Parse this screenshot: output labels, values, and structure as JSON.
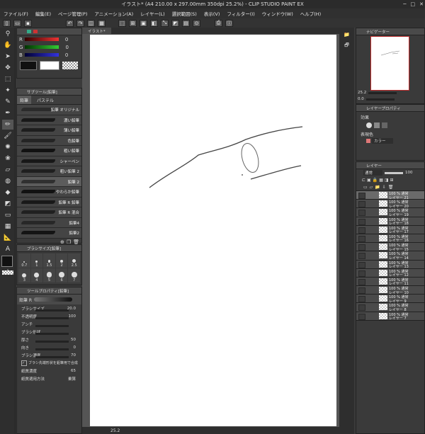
{
  "title": "イラスト* (A4 210.00 x 297.00mm 350dpi 25.2%) - CLIP STUDIO PAINT EX",
  "menu": [
    "ファイル(F)",
    "編集(E)",
    "ページ管理(P)",
    "アニメーション(A)",
    "レイヤー(L)",
    "選択範囲(S)",
    "表示(V)",
    "フィルター(I)",
    "ウィンドウ(W)",
    "ヘルプ(H)"
  ],
  "color_panel": {
    "r_label": "R",
    "g_label": "G",
    "b_label": "B",
    "r": 0,
    "g": 0,
    "b": 0
  },
  "subtool": {
    "header": "サブツール[鉛筆]",
    "tabs": [
      "鉛筆",
      "パステル"
    ],
    "brushes": [
      "鉛筆 オリジナル",
      "濃い鉛筆",
      "薄い鉛筆",
      "色鉛筆",
      "粗い鉛筆",
      "シャーペン",
      "粗い鉛筆 2",
      "鉛筆 2",
      "やわらか鉛筆",
      "鉛筆 R 鉛筆",
      "鉛筆 R 混合",
      "鉛筆4",
      "鉛筆2"
    ],
    "selected_index": 7
  },
  "brush_size_panel": {
    "header": "ブラシサイズ[鉛筆]",
    "sizes": [
      "0.7",
      "1",
      "1.5",
      "2",
      "2.5",
      "3",
      "4",
      "5",
      "6",
      "7"
    ]
  },
  "tool_property": {
    "header": "ツールプロパティ[鉛筆]",
    "brush_name": "鉛筆 R",
    "rows": [
      {
        "label": "ブラシサイズ",
        "value": "20.0"
      },
      {
        "label": "不透明度",
        "value": "100"
      },
      {
        "label": "アンチ",
        "value": ""
      },
      {
        "label": "ブラシ形状",
        "value": ""
      },
      {
        "label": "厚さ",
        "value": "50"
      },
      {
        "label": "向き",
        "value": "0"
      },
      {
        "label": "ブラシ濃度",
        "value": "70"
      }
    ],
    "checkbox_label": "ブラシ先端形状を鉛筆用で合成",
    "paper_density_label": "紙質濃度",
    "paper_density_value": "65",
    "paper_method_label": "紙質適用方法",
    "paper_method_value": "乗算"
  },
  "canvas": {
    "tab": "イラスト*",
    "zoom": "25.2"
  },
  "navigator": {
    "header": "ナビゲーター",
    "zoom": "25.2",
    "angle": "0.0"
  },
  "layer_property": {
    "header": "レイヤープロパティ",
    "effect_label": "効果",
    "expression_label": "表現色",
    "expression_value": "カラー"
  },
  "layer_panel": {
    "header": "レイヤー",
    "blend": "通常",
    "opacity": "100",
    "layers": [
      {
        "top": "100 % 通常",
        "name": "レイヤー 21"
      },
      {
        "top": "100 % 通常",
        "name": "レイヤー 20"
      },
      {
        "top": "100 % 通常",
        "name": "レイヤー 19"
      },
      {
        "top": "100 % 通常",
        "name": "レイヤー 18"
      },
      {
        "top": "100 % 通常",
        "name": "レイヤー 17"
      },
      {
        "top": "100 % 通常",
        "name": "レイヤー 16"
      },
      {
        "top": "100 % 通常",
        "name": "レイヤー 15"
      },
      {
        "top": "100 % 通常",
        "name": "レイヤー 14"
      },
      {
        "top": "100 % 通常",
        "name": "レイヤー 13"
      },
      {
        "top": "100 % 通常",
        "name": "レイヤー 12"
      },
      {
        "top": "100 % 通常",
        "name": "レイヤー 11"
      },
      {
        "top": "100 % 通常",
        "name": "レイヤー 10"
      },
      {
        "top": "100 % 通常",
        "name": "レイヤー 9"
      },
      {
        "top": "100 % 通常",
        "name": "レイヤー 8"
      },
      {
        "top": "100 % 通常",
        "name": "レイヤー 7"
      }
    ],
    "selected_index": 0
  }
}
